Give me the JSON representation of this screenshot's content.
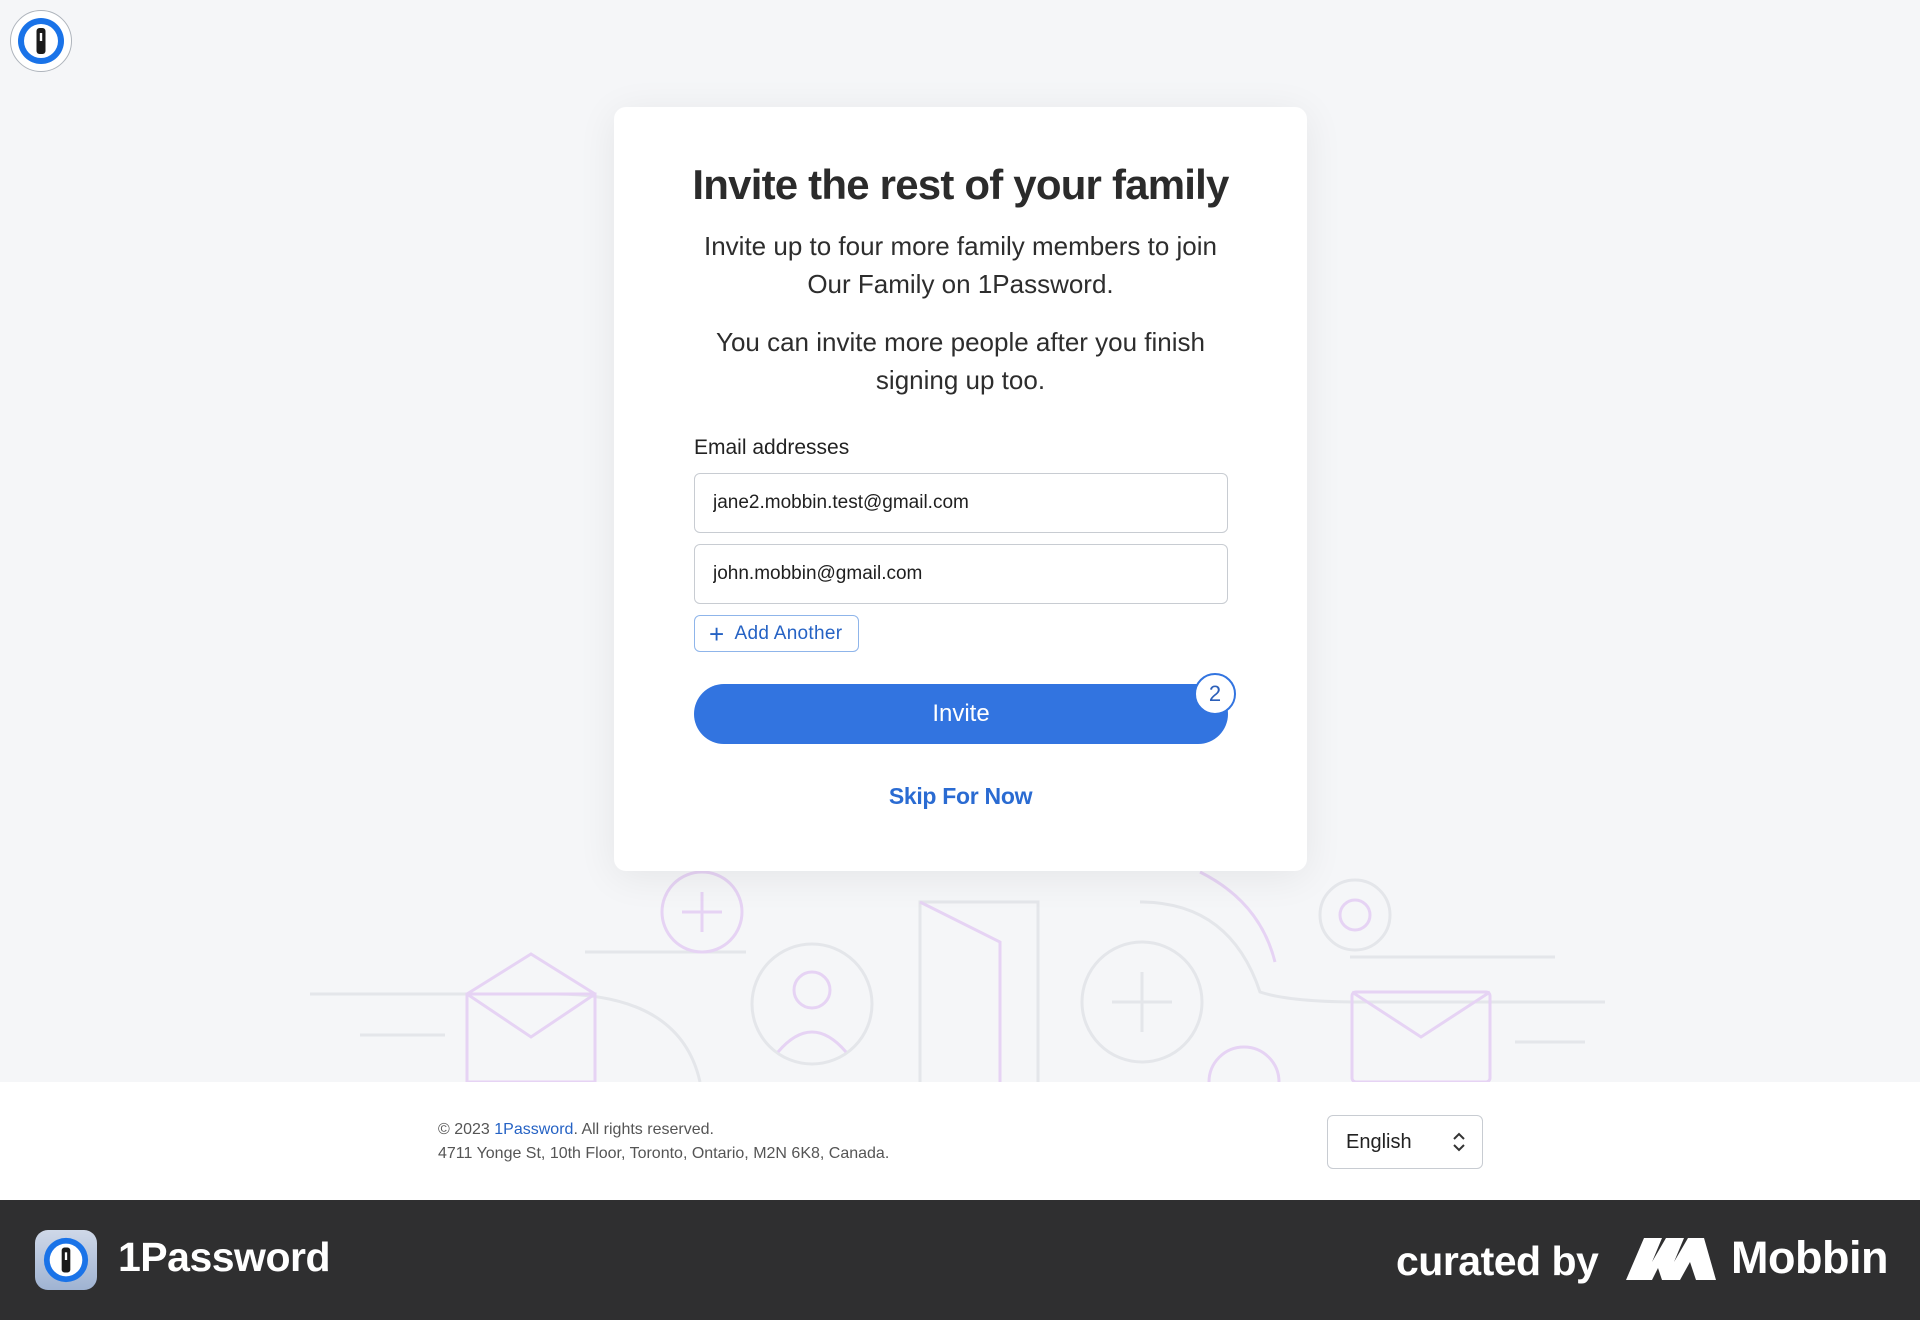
{
  "app": {
    "name": "1Password",
    "logo_icon": "1password-logo-icon"
  },
  "card": {
    "title": "Invite the rest of your family",
    "description_1": "Invite up to four more family members to join Our Family on 1Password.",
    "description_2": "You can invite more people after you finish signing up too.",
    "email_label": "Email addresses",
    "emails": [
      "jane2.mobbin.test@gmail.com",
      "john.mobbin@gmail.com"
    ],
    "add_another_label": "Add Another",
    "invite_label": "Invite",
    "invite_count": "2",
    "skip_label": "Skip For Now"
  },
  "footer": {
    "copyright_prefix": "© 2023 ",
    "copyright_link": "1Password",
    "copyright_suffix": ". All rights reserved.",
    "address": "4711 Yonge St, 10th Floor, Toronto, Ontario, M2N 6K8, Canada.",
    "language": "English"
  },
  "brand_bar": {
    "app_name": "1Password",
    "curated_by": "curated by",
    "curator": "Mobbin"
  },
  "colors": {
    "accent": "#3274e0",
    "link": "#2a6bd2",
    "background": "#f5f6f8",
    "brand_bar": "#2f2f30"
  }
}
